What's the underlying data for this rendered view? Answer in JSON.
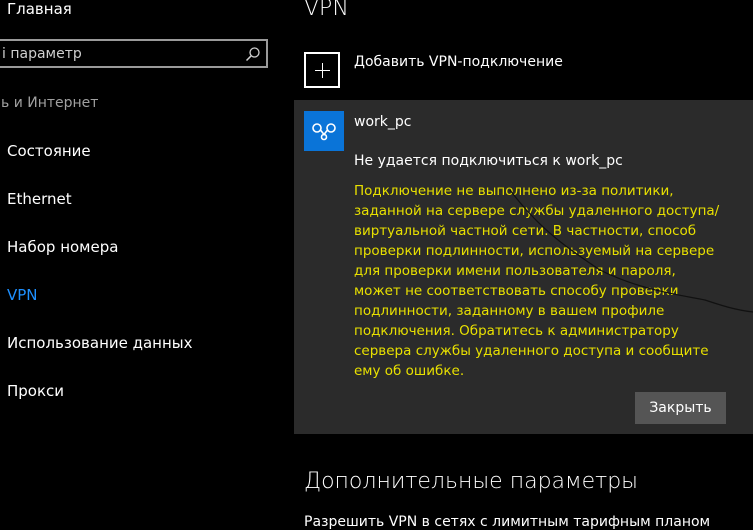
{
  "sidebar": {
    "home_label": "Главная",
    "search_placeholder": "i параметр",
    "section_label": "ь и Интернет",
    "items": [
      {
        "label": "Состояние"
      },
      {
        "label": "Ethernet"
      },
      {
        "label": "Набор номера"
      },
      {
        "label": "VPN",
        "active": true
      },
      {
        "label": "Использование данных"
      },
      {
        "label": "Прокси"
      }
    ]
  },
  "main": {
    "title": "VPN",
    "add_vpn_label": "Добавить VPN-подключение",
    "connection": {
      "name": "work_pc",
      "error_title": "Не удается подключиться к work_pc",
      "error_body": "Подключение не выполнено из-за политики, заданной на сервере службы удаленного доступа/виртуальной частной сети. В частности, способ проверки подлинности, используемый на сервере для проверки имени пользователя и пароля, может не соответствовать способу проверки подлинности, заданному в вашем профиле подключения. Обратитесь к администратору сервера службы удаленного доступа и сообщите ему об ошибке.",
      "close_label": "Закрыть"
    },
    "additional_title": "Дополнительные параметры",
    "metered_label": "Разрешить VPN в сетях с лимитным тарифным планом"
  },
  "colors": {
    "accent": "#0a74d8",
    "active_nav": "#1e90ff",
    "error_text": "#e8e000",
    "card_bg": "#2b2b2b",
    "button_bg": "#555555"
  },
  "icons": {
    "search": "search-icon",
    "add": "plus-icon",
    "vpn": "vpn-connection-icon"
  }
}
